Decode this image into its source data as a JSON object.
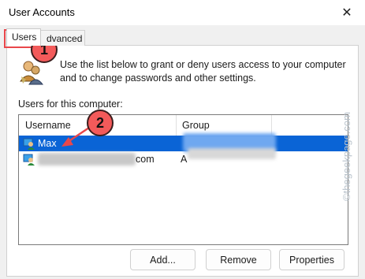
{
  "window": {
    "title": "User Accounts"
  },
  "tabs": [
    {
      "label": "Users"
    },
    {
      "label": "Advanced",
      "visible_fragment": "dvanced"
    }
  ],
  "intro": {
    "text": "Use the list below to grant or deny users access to your computer and to change passwords and other settings."
  },
  "users_list": {
    "label": "Users for this computer:",
    "columns": [
      "Username",
      "Group"
    ],
    "rows": [
      {
        "name": "Max",
        "group": "",
        "selected": true,
        "group_redacted": true
      },
      {
        "name": "com",
        "group": "A",
        "selected": false,
        "name_redacted_prefix": true
      }
    ]
  },
  "buttons": {
    "add": "Add...",
    "remove": "Remove",
    "properties": "Properties"
  },
  "annotations": [
    {
      "number": "1"
    },
    {
      "number": "2"
    }
  ],
  "watermark": "©thegeekpage.com",
  "colors": {
    "selection": "#0a64d6",
    "annotation": "#f35a5a",
    "callout_border": "#e9474b"
  }
}
